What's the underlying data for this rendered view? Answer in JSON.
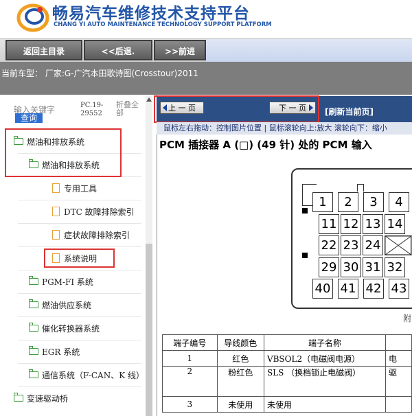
{
  "header": {
    "title": "畅易汽车维修技术支持平台",
    "subtitle": "CHANG YI AUTO MAINTENANCE TECHNOLOGY SUPPORT PLATFORM",
    "brand_color": "#2356a8"
  },
  "nav": {
    "home": "返回主目录",
    "back": "<<后退.",
    "forward": ">>前进"
  },
  "vehicle": {
    "text": "当前车型： 厂家:G-广汽本田歌诗图(Crosstour)2011"
  },
  "search": {
    "label": "输入关键字",
    "query_button": "查询",
    "pc_code": "PC.19-29552",
    "collapse_all": "折叠全部"
  },
  "tree": {
    "items": [
      {
        "label": "燃油和排放系统",
        "icon": "folder-open-icon"
      },
      {
        "label": "燃油和排放系统",
        "icon": "folder-open-icon"
      },
      {
        "label": "专用工具",
        "icon": "document-icon"
      },
      {
        "label": "DTC 故障排除索引",
        "icon": "document-icon"
      },
      {
        "label": "症状故障排除索引",
        "icon": "document-icon"
      },
      {
        "label": "系统说明",
        "icon": "document-icon"
      },
      {
        "label": "PGM-FI 系统",
        "icon": "folder-icon"
      },
      {
        "label": "燃油供应系统",
        "icon": "folder-icon"
      },
      {
        "label": "催化转换器系统",
        "icon": "folder-icon"
      },
      {
        "label": "EGR 系统",
        "icon": "folder-icon"
      },
      {
        "label": "通信系统（F-CAN、K 线）",
        "icon": "folder-icon"
      },
      {
        "label": "变速驱动桥",
        "icon": "folder-icon"
      }
    ]
  },
  "viewer": {
    "prev_page": "上 一 页",
    "next_page": "下 一 页",
    "refresh": "[刷新当前页]",
    "hint": "鼠标左右拖动：控制图片位置 | 鼠标滚轮向上:放大  滚轮向下：缩小"
  },
  "document": {
    "title": "PCM 插接器 A (□) (49 针) 处的 PCM 输入",
    "connector_pins": [
      "1",
      "2",
      "3",
      "4",
      "11",
      "12",
      "13",
      "14",
      "22",
      "23",
      "24",
      "29",
      "30",
      "31",
      "32",
      "40",
      "41",
      "42",
      "43"
    ],
    "attachment_note": "附",
    "table": {
      "headers": [
        "端子编号",
        "导线颜色",
        "端子名称",
        ""
      ],
      "rows": [
        {
          "no": "1",
          "color": "红色",
          "name": "VBSOL2（电磁阀电源）",
          "desc": "电"
        },
        {
          "no": "2",
          "color": "粉红色",
          "name": "SLS （换档锁止电磁阀）",
          "desc": "驱"
        },
        {
          "no": "3",
          "color": "未使用",
          "name": "未使用",
          "desc": ""
        }
      ]
    }
  }
}
